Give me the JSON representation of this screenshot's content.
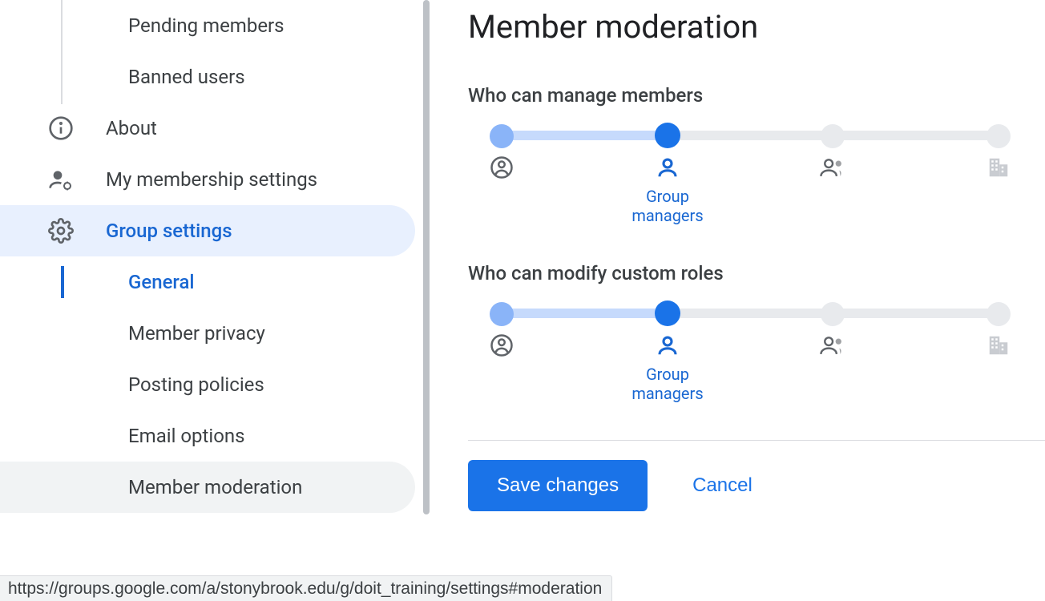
{
  "sidebar": {
    "sub_top": {
      "items": [
        {
          "label": "Pending members"
        },
        {
          "label": "Banned users"
        }
      ]
    },
    "items": [
      {
        "label": "About"
      },
      {
        "label": "My membership settings"
      },
      {
        "label": "Group settings"
      }
    ],
    "sub_settings": {
      "items": [
        {
          "label": "General"
        },
        {
          "label": "Member privacy"
        },
        {
          "label": "Posting policies"
        },
        {
          "label": "Email options"
        },
        {
          "label": "Member moderation"
        }
      ]
    }
  },
  "main": {
    "title": "Member moderation",
    "settings": [
      {
        "label": "Who can manage members",
        "selected_index": 1,
        "selected_label": "Group managers"
      },
      {
        "label": "Who can modify custom roles",
        "selected_index": 1,
        "selected_label": "Group managers"
      }
    ],
    "save_label": "Save changes",
    "cancel_label": "Cancel"
  },
  "status_url": "https://groups.google.com/a/stonybrook.edu/g/doit_training/settings#moderation"
}
